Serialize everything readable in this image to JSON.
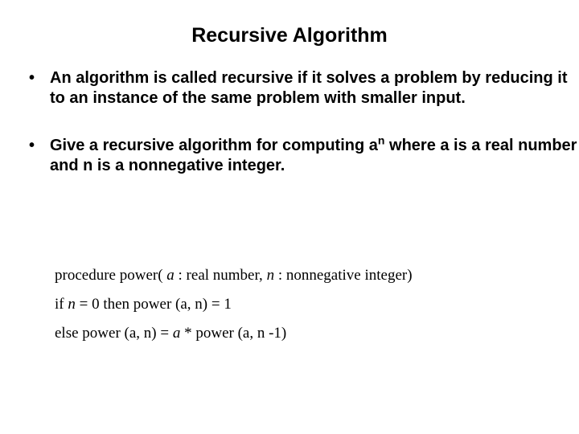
{
  "title": "Recursive Algorithm",
  "bullets": [
    {
      "dot": "•",
      "text": "An algorithm is called recursive if it solves a problem by reducing it to an instance of the same problem with smaller input."
    },
    {
      "dot": "•",
      "prefix": "Give a recursive algorithm for computing a",
      "sup": "n",
      "suffix": " where a is a real number and n is a nonnegative integer."
    }
  ],
  "math": {
    "line1": {
      "kw_procedure": "procedure",
      "fn": " power",
      "open": "( ",
      "a": "a",
      "a_type": " : real number,   ",
      "n": "n",
      "n_type": " : nonnegative integer)"
    },
    "line2": {
      "kw_if": "if ",
      "n": "n",
      "eq0": " = 0 ",
      "kw_then": "then ",
      "pw": "power   ",
      "args": "(a, n)",
      "eq1": " = 1"
    },
    "line3": {
      "kw_else": "else ",
      "pw1": "power   ",
      "args1": "(a, n)",
      "eq": " = ",
      "a": "a",
      "star": " * ",
      "pw2": "power   ",
      "args2": "(a, n -1)"
    }
  }
}
